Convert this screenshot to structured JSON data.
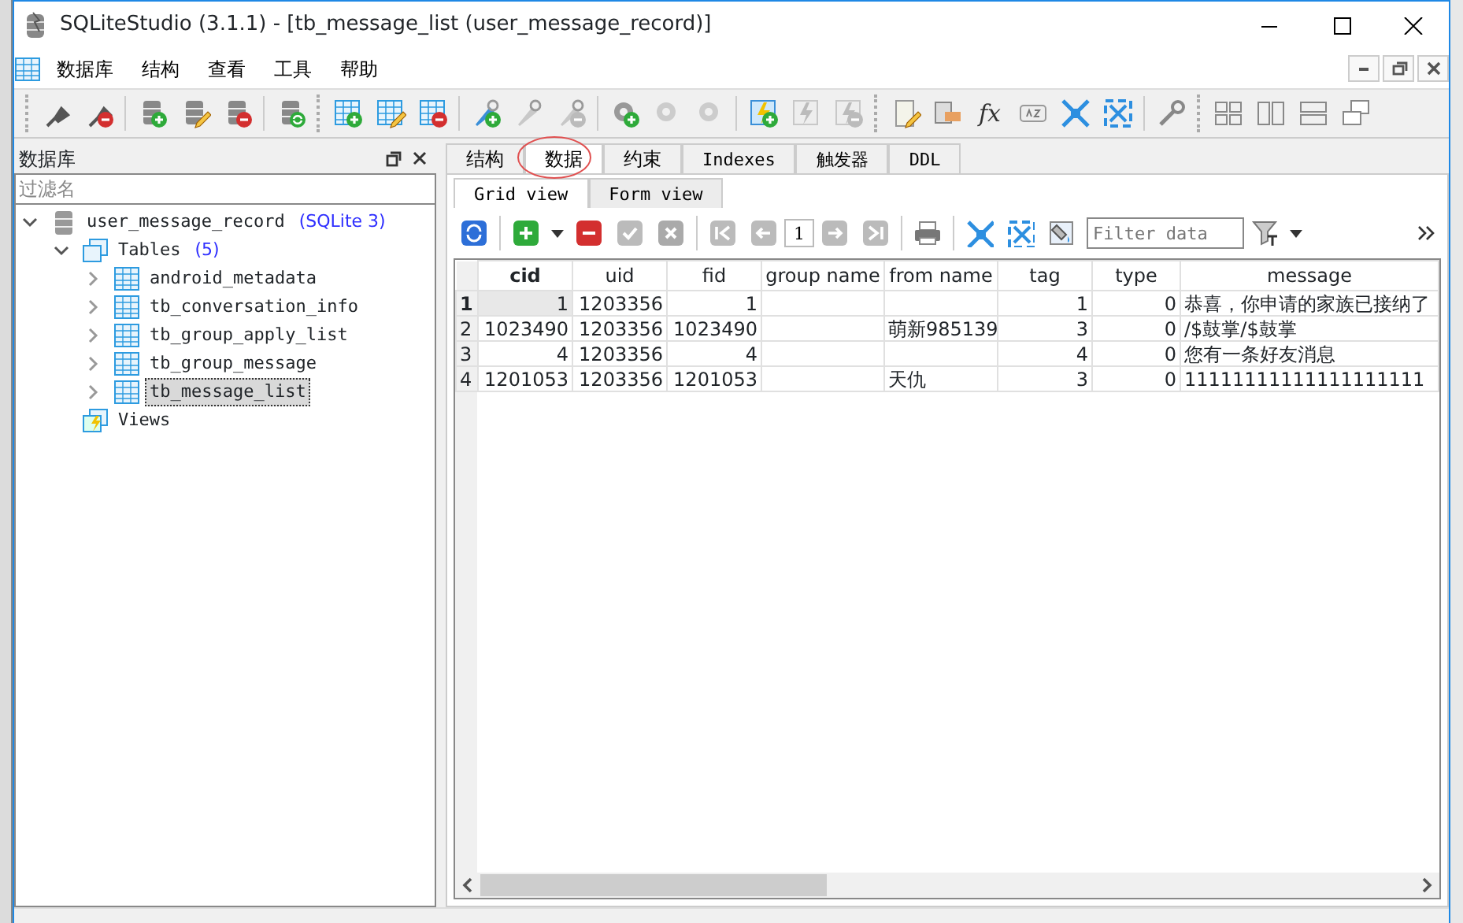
{
  "window": {
    "title": "SQLiteStudio (3.1.1) - [tb_message_list (user_message_record)]"
  },
  "menu": [
    "数据库",
    "结构",
    "查看",
    "工具",
    "帮助"
  ],
  "toolbar": {
    "fx": "fx"
  },
  "database_panel": {
    "title": "数据库",
    "filter": {
      "placeholder": "过滤名"
    },
    "tree": [
      {
        "label": "user_message_record",
        "note": "(SQLite 3)",
        "kind": "database",
        "expanded": true,
        "selected": false,
        "children": [
          {
            "label": "Tables",
            "note": "(5)",
            "kind": "folder",
            "expanded": true,
            "selected": false,
            "children": [
              {
                "label": "android_metadata",
                "kind": "table",
                "expanded": false,
                "selected": false
              },
              {
                "label": "tb_conversation_info",
                "kind": "table",
                "expanded": false,
                "selected": false
              },
              {
                "label": "tb_group_apply_list",
                "kind": "table",
                "expanded": false,
                "selected": false
              },
              {
                "label": "tb_group_message",
                "kind": "table",
                "expanded": false,
                "selected": false
              },
              {
                "label": "tb_message_list",
                "kind": "table",
                "expanded": false,
                "selected": true
              }
            ]
          },
          {
            "label": "Views",
            "kind": "views",
            "selected": false
          }
        ]
      }
    ]
  },
  "tabs": [
    {
      "label": "结构",
      "selected": false
    },
    {
      "label": "数据",
      "selected": true
    },
    {
      "label": "约束",
      "selected": false
    },
    {
      "label": "Indexes",
      "selected": false
    },
    {
      "label": "触发器",
      "selected": false
    },
    {
      "label": "DDL",
      "selected": false
    }
  ],
  "view_tabs": [
    {
      "label": "Grid view",
      "selected": true
    },
    {
      "label": "Form view",
      "selected": false
    }
  ],
  "grid_toolbar": {
    "page": "1",
    "filter": {
      "placeholder": "Filter data"
    }
  },
  "table": {
    "columns": [
      {
        "label": "cid",
        "selected": true
      },
      {
        "label": "uid",
        "selected": false
      },
      {
        "label": "fid",
        "selected": false
      },
      {
        "label": "group name",
        "selected": false
      },
      {
        "label": "from name",
        "selected": false
      },
      {
        "label": "tag",
        "selected": false
      },
      {
        "label": "type",
        "selected": false
      },
      {
        "label": "message",
        "selected": false
      }
    ],
    "rows": [
      {
        "number": "1",
        "selected": true,
        "cells": [
          "1",
          "1203356",
          "1",
          "",
          "",
          "1",
          "0",
          "恭喜，你申请的家族已接纳了"
        ]
      },
      {
        "number": "2",
        "selected": false,
        "cells": [
          "1023490",
          "1203356",
          "1023490",
          "",
          "萌新985139",
          "3",
          "0",
          "/$鼓掌/$鼓掌"
        ]
      },
      {
        "number": "3",
        "selected": false,
        "cells": [
          "4",
          "1203356",
          "4",
          "",
          "",
          "4",
          "0",
          "您有一条好友消息"
        ]
      },
      {
        "number": "4",
        "selected": false,
        "cells": [
          "1201053",
          "1203356",
          "1201053",
          "",
          "天仇",
          "3",
          "0",
          "11111111111111111111"
        ]
      }
    ]
  }
}
